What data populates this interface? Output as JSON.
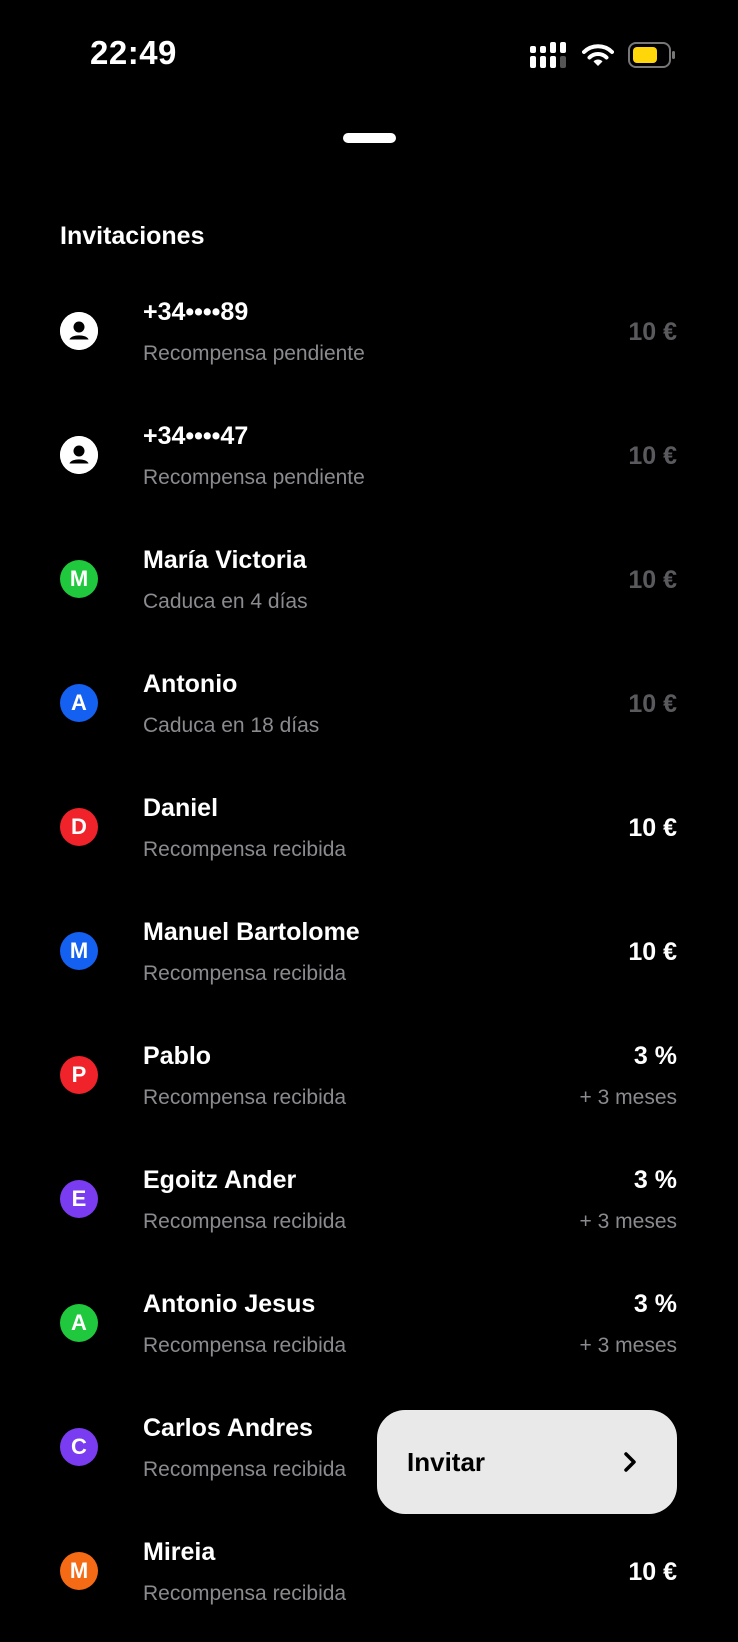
{
  "status_bar": {
    "time": "22:49",
    "battery_color": "#ffd60a"
  },
  "section": {
    "title": "Invitaciones"
  },
  "invitations": [
    {
      "type": "phone",
      "title": "+34••••89",
      "subtitle": "Recompensa pendiente",
      "amount": "10 €",
      "muted": true
    },
    {
      "type": "phone",
      "title": "+34••••47",
      "subtitle": "Recompensa pendiente",
      "amount": "10 €",
      "muted": true
    },
    {
      "type": "initial",
      "initial": "M",
      "color": "#1fc83c",
      "title": "María Victoria",
      "subtitle": "Caduca en 4 días",
      "amount": "10 €",
      "muted": true
    },
    {
      "type": "initial",
      "initial": "A",
      "color": "#1460f0",
      "title": "Antonio",
      "subtitle": "Caduca en 18 días",
      "amount": "10 €",
      "muted": true
    },
    {
      "type": "initial",
      "initial": "D",
      "color": "#f0222a",
      "title": "Daniel",
      "subtitle": "Recompensa recibida",
      "amount": "10 €",
      "muted": false
    },
    {
      "type": "initial",
      "initial": "M",
      "color": "#1460f0",
      "title": "Manuel Bartolome",
      "subtitle": "Recompensa recibida",
      "amount": "10 €",
      "muted": false
    },
    {
      "type": "initial",
      "initial": "P",
      "color": "#f0222a",
      "title": "Pablo",
      "subtitle": "Recompensa recibida",
      "amount": "3 %",
      "extra": "+ 3 meses",
      "muted": false
    },
    {
      "type": "initial",
      "initial": "E",
      "color": "#7a3cf0",
      "title": "Egoitz Ander",
      "subtitle": "Recompensa recibida",
      "amount": "3 %",
      "extra": "+ 3 meses",
      "muted": false
    },
    {
      "type": "initial",
      "initial": "A",
      "color": "#1fc83c",
      "title": "Antonio Jesus",
      "subtitle": "Recompensa recibida",
      "amount": "3 %",
      "extra": "+ 3 meses",
      "muted": false
    },
    {
      "type": "initial",
      "initial": "C",
      "color": "#7a3cf0",
      "title": "Carlos Andres",
      "subtitle": "Recompensa recibida",
      "amount": "",
      "muted": false
    },
    {
      "type": "initial",
      "initial": "M",
      "color": "#f56a14",
      "title": "Mireia",
      "subtitle": "Recompensa recibida",
      "amount": "10 €",
      "muted": false
    }
  ],
  "invite_button": {
    "label": "Invitar",
    "icon": "chevron-right-icon"
  }
}
